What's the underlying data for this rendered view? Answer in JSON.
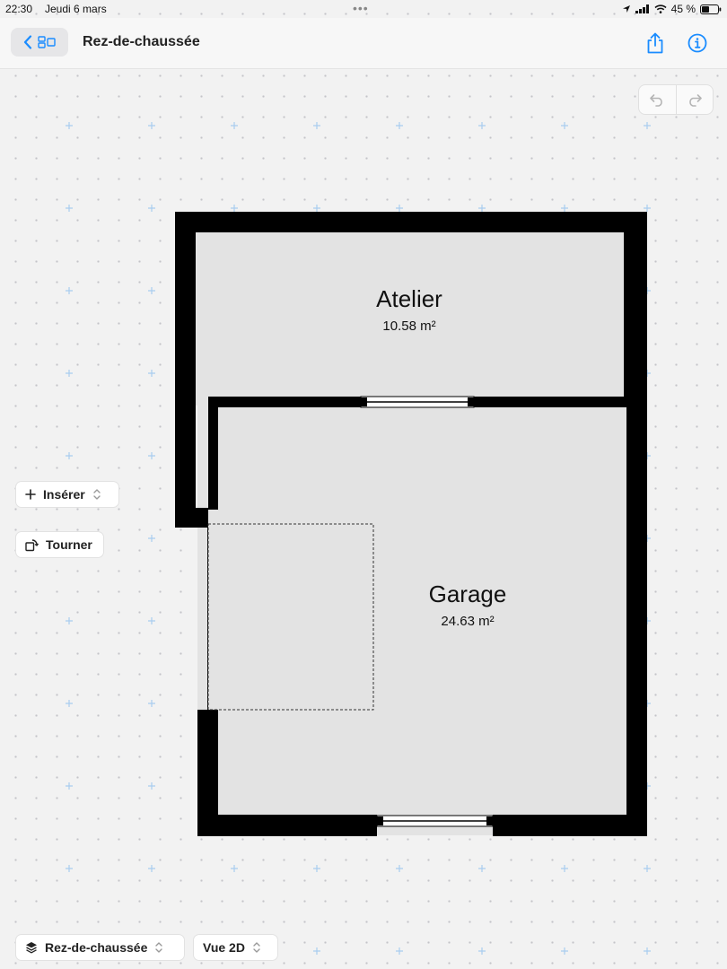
{
  "status_bar": {
    "time": "22:30",
    "date": "Jeudi 6 mars",
    "battery": "45 %"
  },
  "header": {
    "title": "Rez-de-chaussée"
  },
  "rooms": [
    {
      "name": "Atelier",
      "area": "10.58 m²"
    },
    {
      "name": "Garage",
      "area": "24.63 m²"
    }
  ],
  "tools": {
    "insert_label": "Insérer",
    "rotate_label": "Tourner"
  },
  "footer": {
    "level_label": "Rez-de-chaussée",
    "view_label": "Vue 2D"
  },
  "colors": {
    "accent": "#1a8cff",
    "wall": "#000000",
    "room_fill": "#e3e3e3",
    "grid_plus": "#a9cdf0"
  },
  "icons": [
    "chevron-left-icon",
    "sidebar-layout-icon",
    "share-icon",
    "info-icon",
    "undo-icon",
    "redo-icon",
    "plus-icon",
    "rotate-icon",
    "layers-icon",
    "chevron-updown-icon",
    "location-icon",
    "signal-icon",
    "wifi-icon",
    "battery-icon"
  ]
}
